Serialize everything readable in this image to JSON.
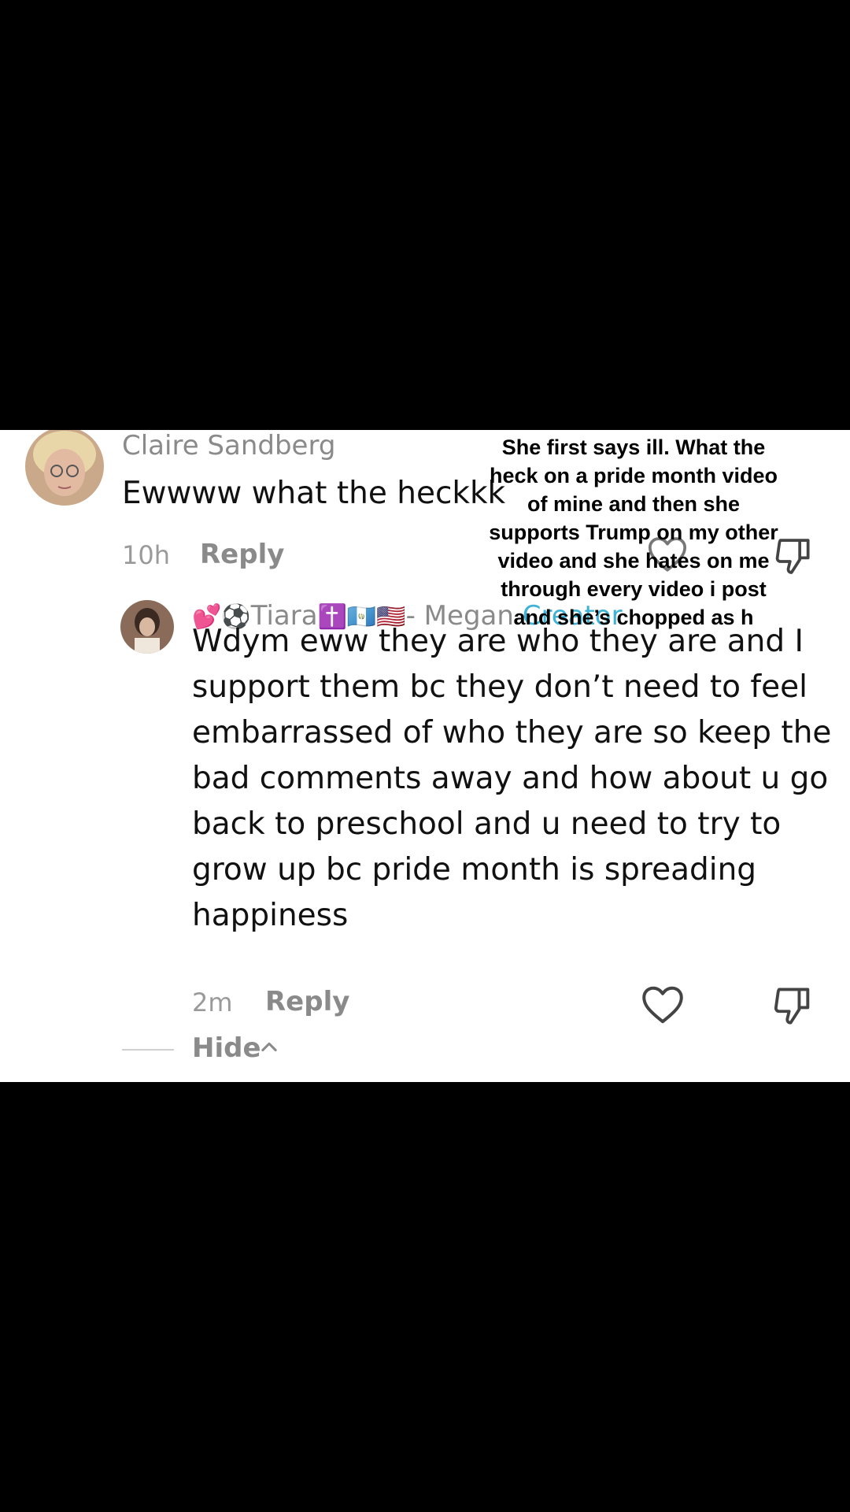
{
  "comments": {
    "parent": {
      "username": "Claire Sandberg",
      "text": "Ewwww what the heckkk",
      "time": "10h",
      "reply_label": "Reply"
    },
    "reply": {
      "username_emoji_prefix": "💕⚽",
      "username_name": "Tiara",
      "username_emoji_suffix": "✝️🇬🇹🇺🇸",
      "username_sep": "- Megan",
      "creator_badge": "Creator",
      "text": "Wdym eww they are who they are and I support them bc they don’t need to feel embarrassed of who they are so keep the bad comments away and how about u go back to preschool and u need to try to grow up bc pride month is spreading happiness",
      "time": "2m",
      "reply_label": "Reply"
    },
    "hide_label": "Hide"
  },
  "overlay_caption": "She first says ill. What the heck on a pride month video of mine and then she supports Trump on my other video and she hates on  me through every video i post  and she’s chopped as h",
  "colors": {
    "background": "#000000",
    "panel": "#ffffff",
    "username": "#8a8a8a",
    "creator_badge": "#3fb2d6"
  },
  "icons": [
    "heart-icon",
    "dislike-icon",
    "chevron-up-icon"
  ]
}
